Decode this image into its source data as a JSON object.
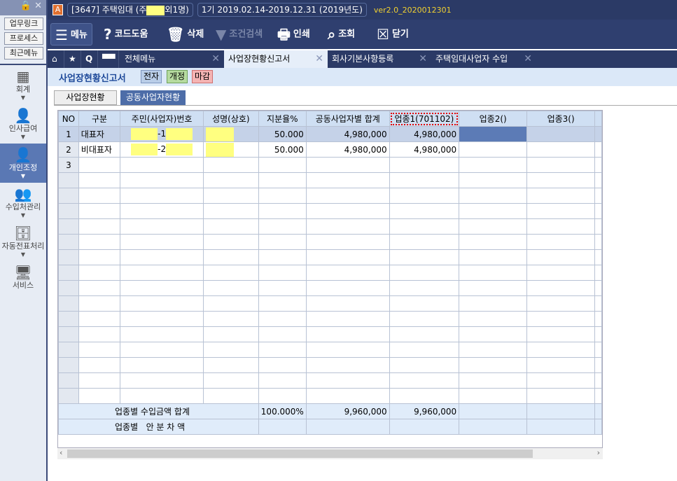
{
  "sidebar": {
    "quick": [
      "업무링크",
      "프로세스",
      "최근메뉴"
    ],
    "items": [
      {
        "label": "회계",
        "icon": "calculator-icon"
      },
      {
        "label": "인사급여",
        "icon": "person-coins-icon"
      },
      {
        "label": "개인조정",
        "icon": "person-icon"
      },
      {
        "label": "수입처관리",
        "icon": "person-building-icon"
      },
      {
        "label": "자동전표처리",
        "icon": "database-icon"
      },
      {
        "label": "서비스",
        "icon": "monitor-icon"
      }
    ]
  },
  "topbar": {
    "company": "[3647] 주택임대 (주",
    "company_suffix": "외1명)",
    "period": "1기 2019.02.14-2019.12.31",
    "year": "(2019년도)",
    "version": "ver2.0_2020012301"
  },
  "toolbar": {
    "menu": "메뉴",
    "code_help": "코드도움",
    "delete": "삭제",
    "filter": "조건검색",
    "print": "인쇄",
    "search": "조회",
    "close": "닫기"
  },
  "tabs": [
    "전체메뉴",
    "사업장현황신고서",
    "회사기본사항등록",
    "주택임대사업자 수입"
  ],
  "header": {
    "title": "사업장현황신고서",
    "badges": [
      "전자",
      "개정",
      "마감"
    ]
  },
  "subtabs": [
    "사업장현황",
    "공동사업자현황"
  ],
  "grid": {
    "columns": [
      "NO",
      "구분",
      "주민(사업자)번호",
      "성명(상호)",
      "지분율%",
      "공동사업자별 합계",
      "업종1(701102)",
      "업종2()",
      "업종3()"
    ],
    "rows": [
      {
        "no": "1",
        "type": "대표자",
        "id_suffix": "-1",
        "share": "50.000",
        "total": "4,980,000",
        "ind1": "4,980,000"
      },
      {
        "no": "2",
        "type": "비대표자",
        "id_suffix": "-2",
        "share": "50.000",
        "total": "4,980,000",
        "ind1": "4,980,000"
      },
      {
        "no": "3"
      }
    ],
    "sum_label": "업종별 수입금액 합계",
    "sum_share": "100.000%",
    "sum_total": "9,960,000",
    "sum_ind1": "9,960,000",
    "diff_label": "업종별   안 분 차 액"
  }
}
